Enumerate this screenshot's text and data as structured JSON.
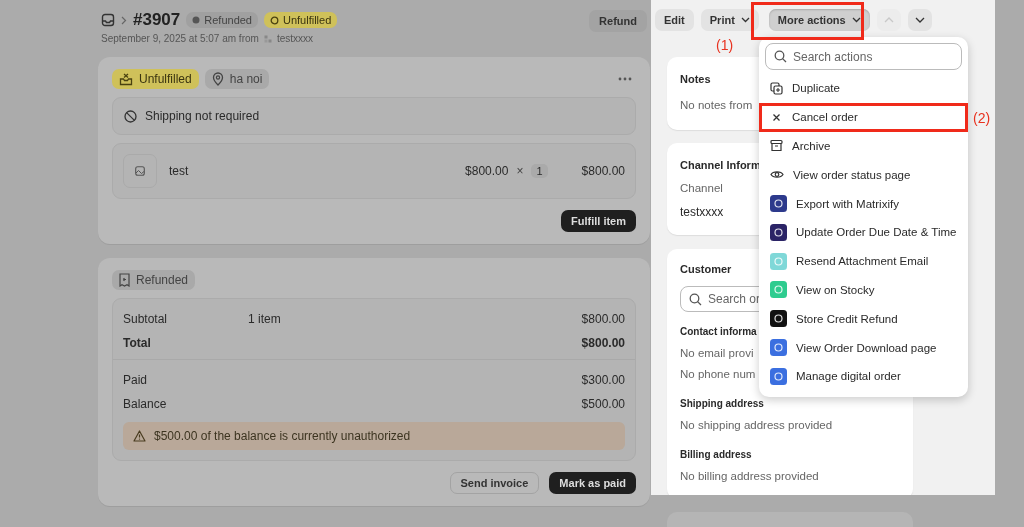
{
  "header": {
    "title": "#3907",
    "badges": [
      {
        "label": "Refunded",
        "kind": "payment"
      },
      {
        "label": "Unfulfilled",
        "kind": "fulfillment"
      }
    ],
    "subtitle": "September 9, 2025 at 5:07 am from",
    "channel": "testxxxx",
    "refund_button": "Refund"
  },
  "toolbar": {
    "buttons": [
      {
        "label": "Edit",
        "dropdown": false,
        "pressed": false
      },
      {
        "label": "Print",
        "dropdown": true,
        "pressed": false
      },
      {
        "label": "More actions",
        "dropdown": true,
        "pressed": true
      }
    ],
    "nav": [
      {
        "kind": "previous",
        "disabled": true
      },
      {
        "kind": "next",
        "disabled": false
      }
    ]
  },
  "fulfillment": {
    "status": "Unfulfilled",
    "location": "ha noi",
    "shipping_note": "Shipping not required",
    "line_item": {
      "name": "test",
      "price": "$800.00",
      "times": "×",
      "quantity": "1",
      "total": "$800.00"
    },
    "button": "Fulfill item"
  },
  "payment": {
    "status": "Refunded",
    "summary": [
      {
        "label": "Subtotal",
        "detail": "1 item",
        "amount": "$800.00",
        "bold": false
      },
      {
        "label": "Total",
        "amount": "$800.00",
        "bold": true
      }
    ],
    "balance": [
      {
        "label": "Paid",
        "amount": "$300.00"
      },
      {
        "label": "Balance",
        "amount": "$500.00"
      }
    ],
    "warning": "$500.00 of the balance is currently unauthorized",
    "buttons": [
      {
        "label": "Send invoice",
        "primary": false
      },
      {
        "label": "Mark as paid",
        "primary": true
      }
    ]
  },
  "notes": {
    "title": "Notes",
    "text": "No notes from"
  },
  "channel_info": {
    "title": "Channel Inform",
    "label": "Channel",
    "value": "testxxxx"
  },
  "customer": {
    "title": "Customer",
    "search": {
      "placeholder": "Search or"
    },
    "sections": [
      {
        "title": "Contact informa",
        "lines": [
          "No email provi",
          "No phone num"
        ]
      },
      {
        "title": "Shipping address",
        "lines": [
          "No shipping address provided"
        ]
      },
      {
        "title": "Billing address",
        "lines": [
          "No billing address provided"
        ]
      }
    ]
  },
  "actions_menu": {
    "search": {
      "placeholder": "Search actions"
    },
    "items": [
      {
        "label": "Duplicate",
        "kind": "duplicate",
        "highlighted": false
      },
      {
        "label": "Cancel order",
        "kind": "cancel",
        "highlighted": true
      },
      {
        "label": "Archive",
        "kind": "archive",
        "highlighted": false
      },
      {
        "label": "View order status page",
        "kind": "view",
        "highlighted": false
      },
      {
        "label": "Export with Matrixify",
        "kind": "app",
        "color": "#2d3a8c",
        "highlighted": false
      },
      {
        "label": "Update Order Due Date & Time",
        "kind": "app",
        "color": "#2b2466",
        "highlighted": false
      },
      {
        "label": "Resend Attachment Email",
        "kind": "app",
        "color": "#7fd8d8",
        "highlighted": false
      },
      {
        "label": "View on Stocky",
        "kind": "app",
        "color": "#2ecc8f",
        "highlighted": false
      },
      {
        "label": "Store Credit Refund",
        "kind": "app",
        "color": "#111111",
        "highlighted": false
      },
      {
        "label": "View Order Download page",
        "kind": "app",
        "color": "#3b6fe0",
        "highlighted": false
      },
      {
        "label": "Manage digital order",
        "kind": "app",
        "color": "#3b6fe0",
        "highlighted": false
      }
    ]
  },
  "annotations": [
    {
      "label": "(1)"
    },
    {
      "label": "(2)"
    }
  ]
}
